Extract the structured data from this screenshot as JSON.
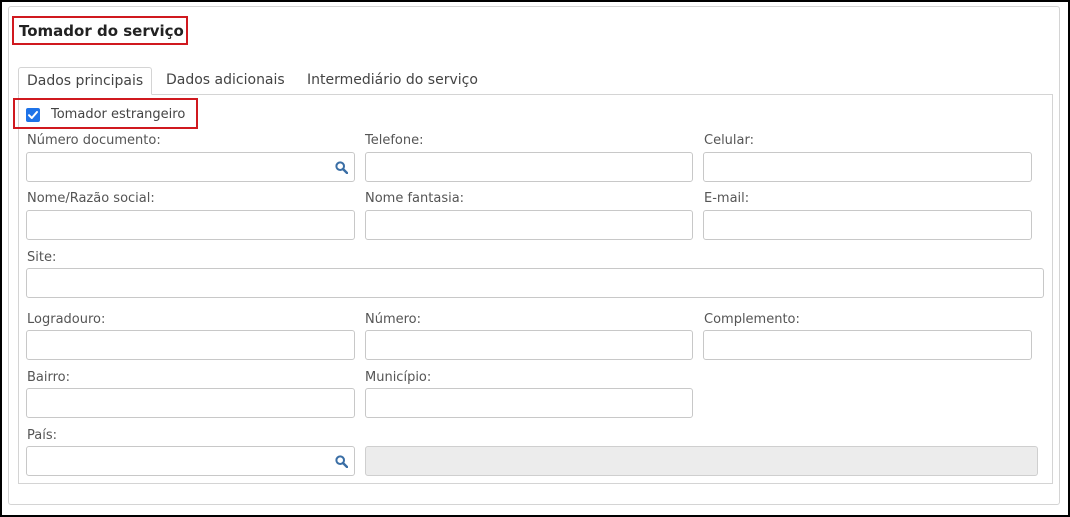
{
  "section": {
    "title": "Tomador do serviço"
  },
  "tabs": [
    {
      "label": "Dados principais",
      "active": true
    },
    {
      "label": "Dados adicionais",
      "active": false
    },
    {
      "label": "Intermediário do serviço",
      "active": false
    }
  ],
  "checkbox": {
    "label": "Tomador estrangeiro",
    "checked": true,
    "color": "#1e73e8"
  },
  "fields": {
    "numero_documento": {
      "label": "Número documento:",
      "value": "",
      "icon": "search-icon"
    },
    "telefone": {
      "label": "Telefone:",
      "value": ""
    },
    "celular": {
      "label": "Celular:",
      "value": ""
    },
    "nome_razao": {
      "label": "Nome/Razão social:",
      "value": ""
    },
    "nome_fantasia": {
      "label": "Nome fantasia:",
      "value": ""
    },
    "email": {
      "label": "E-mail:",
      "value": ""
    },
    "site": {
      "label": "Site:",
      "value": ""
    },
    "logradouro": {
      "label": "Logradouro:",
      "value": ""
    },
    "numero": {
      "label": "Número:",
      "value": ""
    },
    "complemento": {
      "label": "Complemento:",
      "value": ""
    },
    "bairro": {
      "label": "Bairro:",
      "value": ""
    },
    "municipio": {
      "label": "Município:",
      "value": ""
    },
    "pais": {
      "label": "País:",
      "value": "",
      "icon": "search-icon",
      "description": ""
    }
  },
  "colors": {
    "highlight": "#d0191f",
    "border": "#c8c8c8",
    "disabled_bg": "#ececec"
  }
}
